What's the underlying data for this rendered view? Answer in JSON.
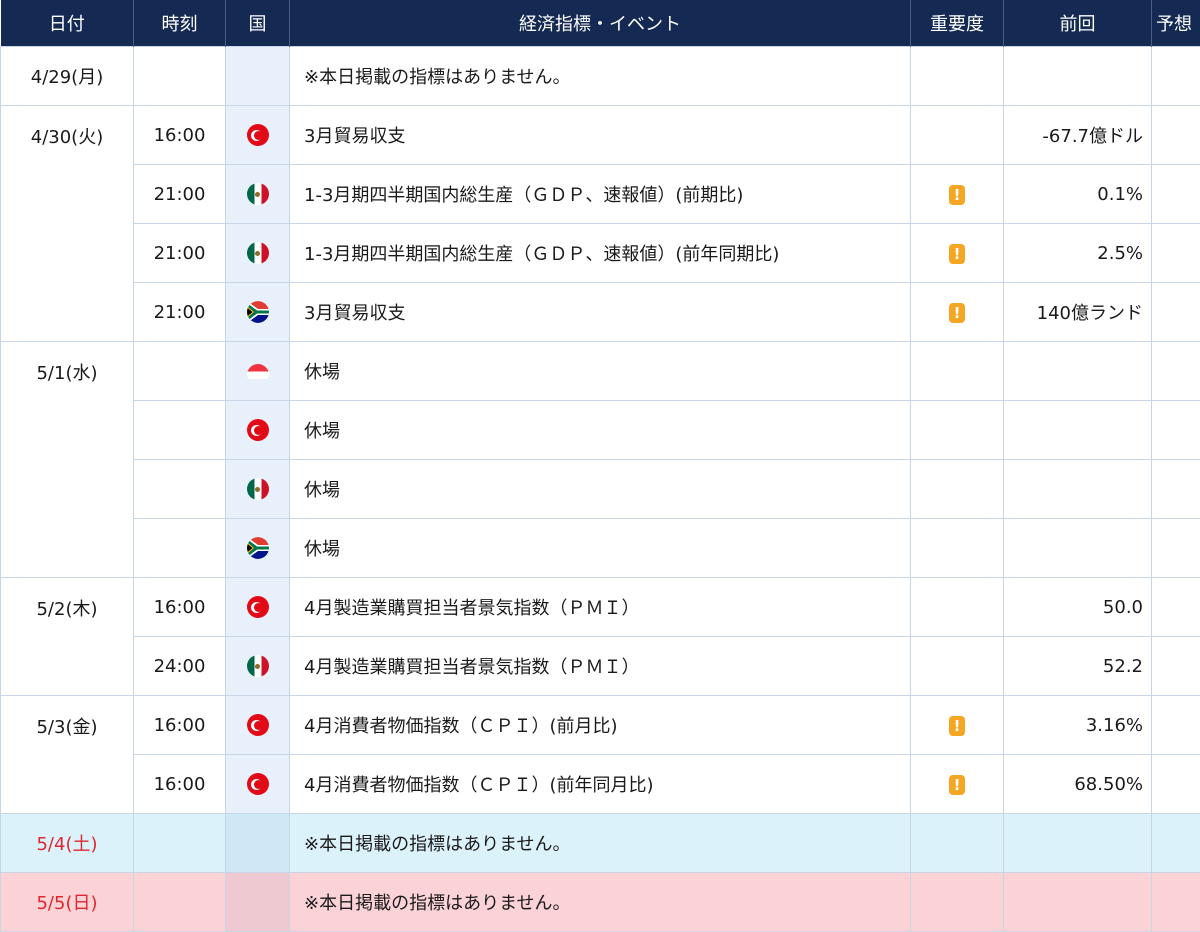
{
  "header": {
    "date": "日付",
    "time": "時刻",
    "country": "国",
    "event": "経済指標・イベント",
    "importance": "重要度",
    "previous": "前回",
    "forecast": "予想"
  },
  "importance_glyph": "!",
  "colors": {
    "header_bg": "#142a52",
    "weekend_sat_bg": "#dcf2fa",
    "weekend_sun_bg": "#fbd3d7",
    "weekend_date_text": "#e0262f",
    "importance_badge": "#f5a623"
  },
  "rows": [
    {
      "date": "4/29(月)",
      "time": "",
      "country": "",
      "flag_icon": "",
      "event": "※本日掲載の指標はありません。",
      "important": false,
      "previous": "",
      "forecast": ""
    },
    {
      "date": "4/30(火)",
      "time": "16:00",
      "country": "turkey",
      "flag_icon": "turkey-flag-icon",
      "event": "3月貿易収支",
      "important": false,
      "previous": "-67.7億ドル",
      "forecast": ""
    },
    {
      "date": "",
      "time": "21:00",
      "country": "mexico",
      "flag_icon": "mexico-flag-icon",
      "event": "1-3月期四半期国内総生産（ＧＤＰ、速報値）(前期比)",
      "important": true,
      "previous": "0.1%",
      "forecast": ""
    },
    {
      "date": "",
      "time": "21:00",
      "country": "mexico",
      "flag_icon": "mexico-flag-icon",
      "event": "1-3月期四半期国内総生産（ＧＤＰ、速報値）(前年同期比)",
      "important": true,
      "previous": "2.5%",
      "forecast": ""
    },
    {
      "date": "",
      "time": "21:00",
      "country": "south-africa",
      "flag_icon": "south-africa-flag-icon",
      "event": "3月貿易収支",
      "important": true,
      "previous": "140億ランド",
      "forecast": ""
    },
    {
      "date": "5/1(水)",
      "time": "",
      "country": "singapore",
      "flag_icon": "singapore-flag-icon",
      "event": "休場",
      "important": false,
      "previous": "",
      "forecast": ""
    },
    {
      "date": "",
      "time": "",
      "country": "turkey",
      "flag_icon": "turkey-flag-icon",
      "event": "休場",
      "important": false,
      "previous": "",
      "forecast": ""
    },
    {
      "date": "",
      "time": "",
      "country": "mexico",
      "flag_icon": "mexico-flag-icon",
      "event": "休場",
      "important": false,
      "previous": "",
      "forecast": ""
    },
    {
      "date": "",
      "time": "",
      "country": "south-africa",
      "flag_icon": "south-africa-flag-icon",
      "event": "休場",
      "important": false,
      "previous": "",
      "forecast": ""
    },
    {
      "date": "5/2(木)",
      "time": "16:00",
      "country": "turkey",
      "flag_icon": "turkey-flag-icon",
      "event": "4月製造業購買担当者景気指数（ＰＭＩ）",
      "important": false,
      "previous": "50.0",
      "forecast": ""
    },
    {
      "date": "",
      "time": "24:00",
      "country": "mexico",
      "flag_icon": "mexico-flag-icon",
      "event": "4月製造業購買担当者景気指数（ＰＭＩ）",
      "important": false,
      "previous": "52.2",
      "forecast": ""
    },
    {
      "date": "5/3(金)",
      "time": "16:00",
      "country": "turkey",
      "flag_icon": "turkey-flag-icon",
      "event": "4月消費者物価指数（ＣＰＩ）(前月比)",
      "important": true,
      "previous": "3.16%",
      "forecast": ""
    },
    {
      "date": "",
      "time": "16:00",
      "country": "turkey",
      "flag_icon": "turkey-flag-icon",
      "event": "4月消費者物価指数（ＣＰＩ）(前年同月比)",
      "important": true,
      "previous": "68.50%",
      "forecast": ""
    },
    {
      "date": "5/4(土)",
      "time": "",
      "country": "",
      "flag_icon": "",
      "event": "※本日掲載の指標はありません。",
      "important": false,
      "previous": "",
      "forecast": "",
      "weekend": "sat"
    },
    {
      "date": "5/5(日)",
      "time": "",
      "country": "",
      "flag_icon": "",
      "event": "※本日掲載の指標はありません。",
      "important": false,
      "previous": "",
      "forecast": "",
      "weekend": "sun"
    }
  ]
}
